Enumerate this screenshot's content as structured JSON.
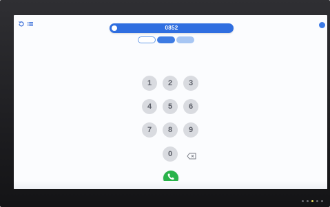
{
  "dialer": {
    "number": "0852",
    "tabs": [
      "",
      "",
      ""
    ],
    "keys": [
      "1",
      "2",
      "3",
      "4",
      "5",
      "6",
      "7",
      "8",
      "9",
      "0"
    ]
  },
  "icons": {
    "history": "history-icon",
    "menu": "menu-icon",
    "back": "back-icon",
    "settings": "settings-icon",
    "backspace": "backspace-icon",
    "call": "phone-icon"
  },
  "colors": {
    "accent": "#2f6ee0",
    "call": "#29b34a",
    "key_bg": "#d9dbe0"
  }
}
